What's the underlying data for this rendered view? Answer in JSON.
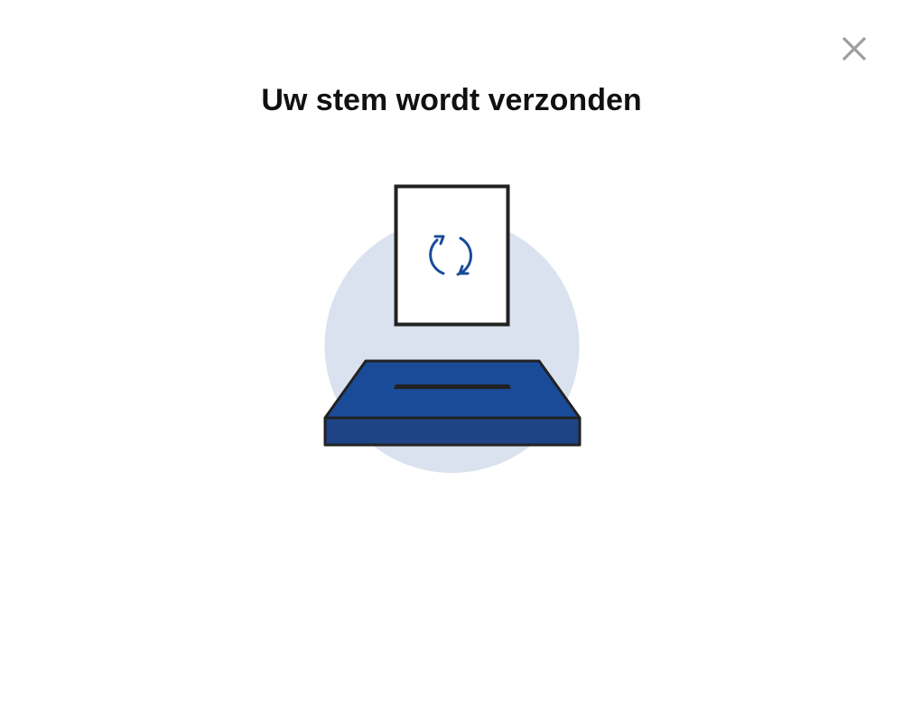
{
  "dialog": {
    "title": "Uw stem wordt verzonden",
    "close_icon": "close-icon"
  },
  "illustration": {
    "icons": [
      "ballot-paper-icon",
      "refresh-icon",
      "ballot-box-icon"
    ],
    "colors": {
      "circle": "#d9e2ee",
      "box_top": "#1a4b99",
      "box_front": "#1e4486",
      "outline": "#222222",
      "refresh": "#1a4b99",
      "close": "#9e9e9e"
    }
  }
}
